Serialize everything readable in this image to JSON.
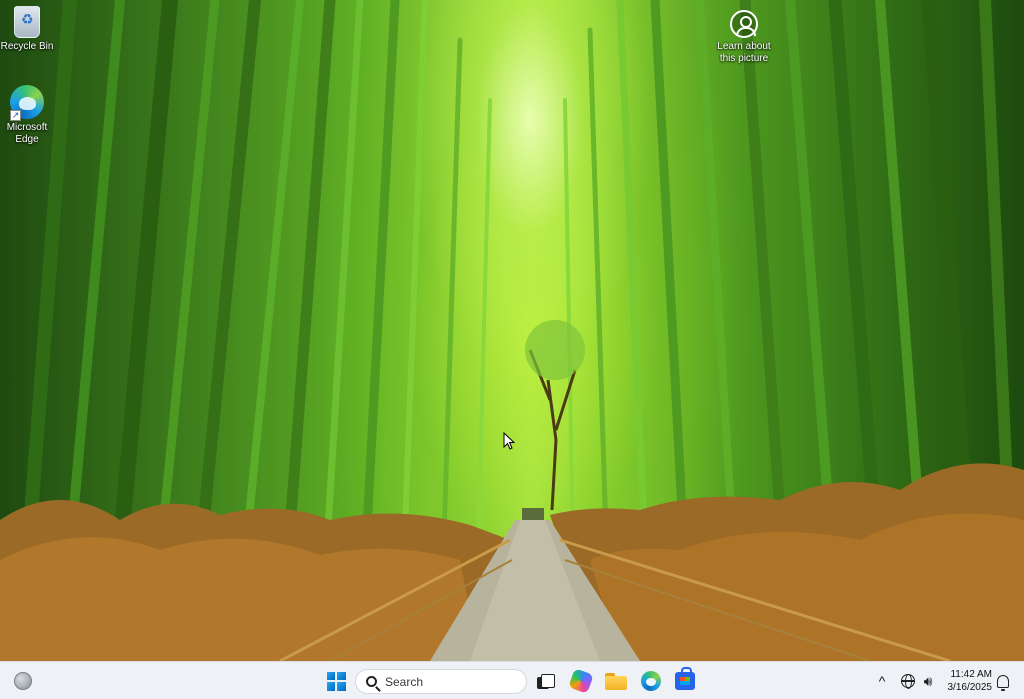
{
  "desktop": {
    "icons": [
      {
        "label": "Recycle Bin",
        "icon": "recycle-bin-icon"
      },
      {
        "label": "Microsoft Edge",
        "icon": "edge-icon"
      },
      {
        "label": "Learn about this picture",
        "icon": "learn-about-picture-icon"
      }
    ],
    "wallpaper": "bamboo forest path"
  },
  "taskbar": {
    "search_placeholder": "Search",
    "apps": [
      {
        "name": "Start",
        "icon": "windows-start-icon"
      },
      {
        "name": "Task View",
        "icon": "task-view-icon"
      },
      {
        "name": "Copilot",
        "icon": "copilot-icon"
      },
      {
        "name": "File Explorer",
        "icon": "file-explorer-icon"
      },
      {
        "name": "Microsoft Edge",
        "icon": "edge-icon"
      },
      {
        "name": "Microsoft Store",
        "icon": "store-icon"
      }
    ],
    "tray": {
      "chevron": "^",
      "time": "11:42 AM",
      "date": "3/16/2025"
    }
  },
  "colors": {
    "taskbar_bg": "#eef1f5",
    "accent": "#0067c0"
  }
}
